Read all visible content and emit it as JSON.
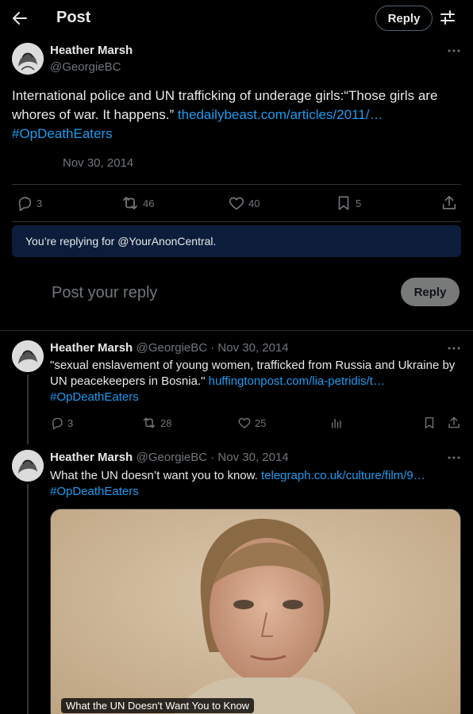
{
  "header": {
    "title": "Post",
    "reply_label": "Reply"
  },
  "main_post": {
    "author_name": "Heather Marsh",
    "author_handle": "@GeorgieBC",
    "text": "International police and UN trafficking of underage girls:“Those girls are whores of war. It happens.” ",
    "link": "thedailybeast.com/articles/2011/…",
    "hashtag": "#OpDeathEaters",
    "date": "Nov 30, 2014",
    "stats": {
      "replies": "3",
      "reposts": "46",
      "likes": "40",
      "bookmarks": "5"
    }
  },
  "reply_banner": "You’re replying for @YourAnonCentral.",
  "composer": {
    "placeholder": "Post your reply",
    "button_label": "Reply"
  },
  "thread": [
    {
      "author_name": "Heather Marsh",
      "meta": "@GeorgieBC · Nov 30, 2014",
      "text": "\"sexual enslavement of young women, trafficked from Russia and Ukraine by UN peacekeepers in Bosnia.\" ",
      "link": "huffingtonpost.com/lia-petridis/t…",
      "hashtag": "#OpDeathEaters",
      "replies": "3",
      "reposts": "28",
      "likes": "25"
    },
    {
      "author_name": "Heather Marsh",
      "meta": "@GeorgieBC · Nov 30, 2014",
      "text": "What the UN doesn’t want you to know. ",
      "link": "telegraph.co.uk/culture/film/9…",
      "hashtag": "#OpDeathEaters",
      "media_caption": "What the UN Doesn't Want You to Know"
    }
  ],
  "colors": {
    "accent": "#1d9bf0",
    "background": "#000000",
    "muted": "#71767b",
    "banner": "#0b1d3a"
  }
}
